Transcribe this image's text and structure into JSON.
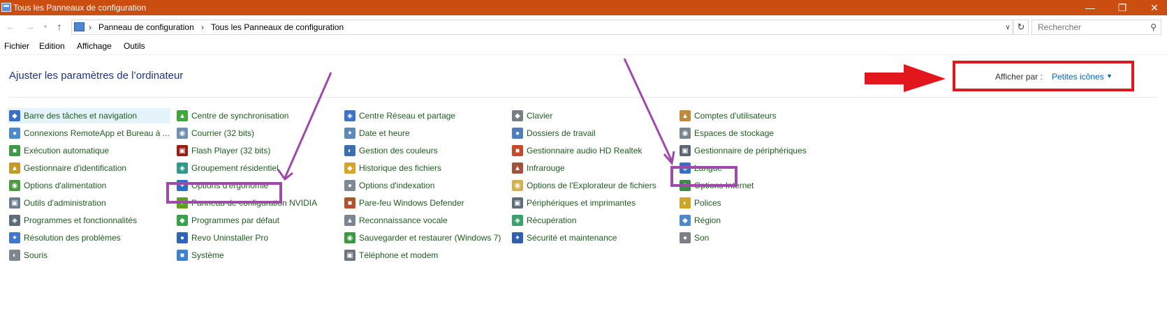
{
  "window": {
    "title": "Tous les Panneaux de configuration",
    "minimize_glyph": "—",
    "maximize_glyph": "❐",
    "close_glyph": "✕"
  },
  "nav": {
    "back_glyph": "←",
    "forward_glyph": "→",
    "recent_glyph": "▾",
    "up_glyph": "↑",
    "breadcrumb_sep": "›",
    "breadcrumb": [
      "Panneau de configuration",
      "Tous les Panneaux de configuration"
    ],
    "dropdown_glyph": "∨",
    "refresh_glyph": "↻",
    "search_placeholder": "Rechercher",
    "search_glyph": "⚲"
  },
  "menu": [
    "Fichier",
    "Edition",
    "Affichage",
    "Outils"
  ],
  "page": {
    "title": "Ajuster les paramètres de l’ordinateur",
    "view_by_label": "Afficher par :",
    "view_by_value": "Petites icônes",
    "view_by_caret": "▼"
  },
  "columns": [
    [
      {
        "label": "Barre des tâches et navigation",
        "icon": "taskbar-icon",
        "color": "#3b6fc2"
      },
      {
        "label": "Connexions RemoteApp et Bureau à ...",
        "icon": "remoteapp-icon",
        "color": "#4a8bd0"
      },
      {
        "label": "Exécution automatique",
        "icon": "autoplay-icon",
        "color": "#3f9a46"
      },
      {
        "label": "Gestionnaire d'identification",
        "icon": "credential-icon",
        "color": "#c69a2a"
      },
      {
        "label": "Options d'alimentation",
        "icon": "power-icon",
        "color": "#4c9b3f"
      },
      {
        "label": "Outils d'administration",
        "icon": "admin-tools-icon",
        "color": "#6b7d8f"
      },
      {
        "label": "Programmes et fonctionnalités",
        "icon": "programs-icon",
        "color": "#5d6b78"
      },
      {
        "label": "Résolution des problèmes",
        "icon": "troubleshoot-icon",
        "color": "#3f78c9"
      },
      {
        "label": "Souris",
        "icon": "mouse-icon",
        "color": "#7d8790"
      }
    ],
    [
      {
        "label": "Centre de synchronisation",
        "icon": "sync-icon",
        "color": "#3ea63a"
      },
      {
        "label": "Courrier (32 bits)",
        "icon": "mail-icon",
        "color": "#6f8fb3"
      },
      {
        "label": "Flash Player (32 bits)",
        "icon": "flash-icon",
        "color": "#9b1a14"
      },
      {
        "label": "Groupement résidentiel",
        "icon": "homegroup-icon",
        "color": "#2f9a8a"
      },
      {
        "label": "Options d'ergonomie",
        "icon": "ease-of-access-icon",
        "color": "#2e6fc4"
      },
      {
        "label": "Panneau de configuration NVIDIA",
        "icon": "nvidia-icon",
        "color": "#5f9f1f"
      },
      {
        "label": "Programmes par défaut",
        "icon": "default-programs-icon",
        "color": "#3aa14a"
      },
      {
        "label": "Revo Uninstaller Pro",
        "icon": "revo-icon",
        "color": "#2d63b8"
      },
      {
        "label": "Système",
        "icon": "system-icon",
        "color": "#3d82cc"
      }
    ],
    [
      {
        "label": "Centre Réseau et partage",
        "icon": "network-icon",
        "color": "#3f74c5"
      },
      {
        "label": "Date et heure",
        "icon": "clock-icon",
        "color": "#5e88b8"
      },
      {
        "label": "Gestion des couleurs",
        "icon": "color-management-icon",
        "color": "#3c6fb0"
      },
      {
        "label": "Historique des fichiers",
        "icon": "file-history-icon",
        "color": "#d9a425"
      },
      {
        "label": "Options d'indexation",
        "icon": "indexing-icon",
        "color": "#7d8a96"
      },
      {
        "label": "Pare-feu Windows Defender",
        "icon": "firewall-icon",
        "color": "#b5502d"
      },
      {
        "label": "Reconnaissance vocale",
        "icon": "microphone-icon",
        "color": "#7a858f"
      },
      {
        "label": "Sauvegarder et restaurer (Windows 7)",
        "icon": "backup-icon",
        "color": "#3a9a3f"
      },
      {
        "label": "Téléphone et modem",
        "icon": "phone-icon",
        "color": "#6a7580"
      }
    ],
    [
      {
        "label": "Clavier",
        "icon": "keyboard-icon",
        "color": "#7a7f86"
      },
      {
        "label": "Dossiers de travail",
        "icon": "work-folders-icon",
        "color": "#4d7dbd"
      },
      {
        "label": "Gestionnaire audio HD Realtek",
        "icon": "realtek-icon",
        "color": "#c64b2b"
      },
      {
        "label": "Infrarouge",
        "icon": "infrared-icon",
        "color": "#a0523a"
      },
      {
        "label": "Options de l'Explorateur de fichiers",
        "icon": "folder-options-icon",
        "color": "#d6b04a"
      },
      {
        "label": "Périphériques et imprimantes",
        "icon": "printer-icon",
        "color": "#5e6c7a"
      },
      {
        "label": "Récupération",
        "icon": "recovery-icon",
        "color": "#3aa06c"
      },
      {
        "label": "Sécurité et maintenance",
        "icon": "flag-icon",
        "color": "#2f5fb0"
      }
    ],
    [
      {
        "label": "Comptes d'utilisateurs",
        "icon": "user-accounts-icon",
        "color": "#c08a3a"
      },
      {
        "label": "Espaces de stockage",
        "icon": "storage-icon",
        "color": "#7b858e"
      },
      {
        "label": "Gestionnaire de périphériques",
        "icon": "device-manager-icon",
        "color": "#5a6673"
      },
      {
        "label": "Langue",
        "icon": "language-icon",
        "color": "#3570c2"
      },
      {
        "label": "Options Internet",
        "icon": "internet-options-icon",
        "color": "#3d8a4a"
      },
      {
        "label": "Polices",
        "icon": "fonts-icon",
        "color": "#d0a426"
      },
      {
        "label": "Région",
        "icon": "globe-icon",
        "color": "#4f88c8"
      },
      {
        "label": "Son",
        "icon": "speaker-icon",
        "color": "#7b8088"
      }
    ]
  ],
  "annotation_colors": {
    "purple": "#9d4aa8",
    "red": "#e2171e"
  }
}
